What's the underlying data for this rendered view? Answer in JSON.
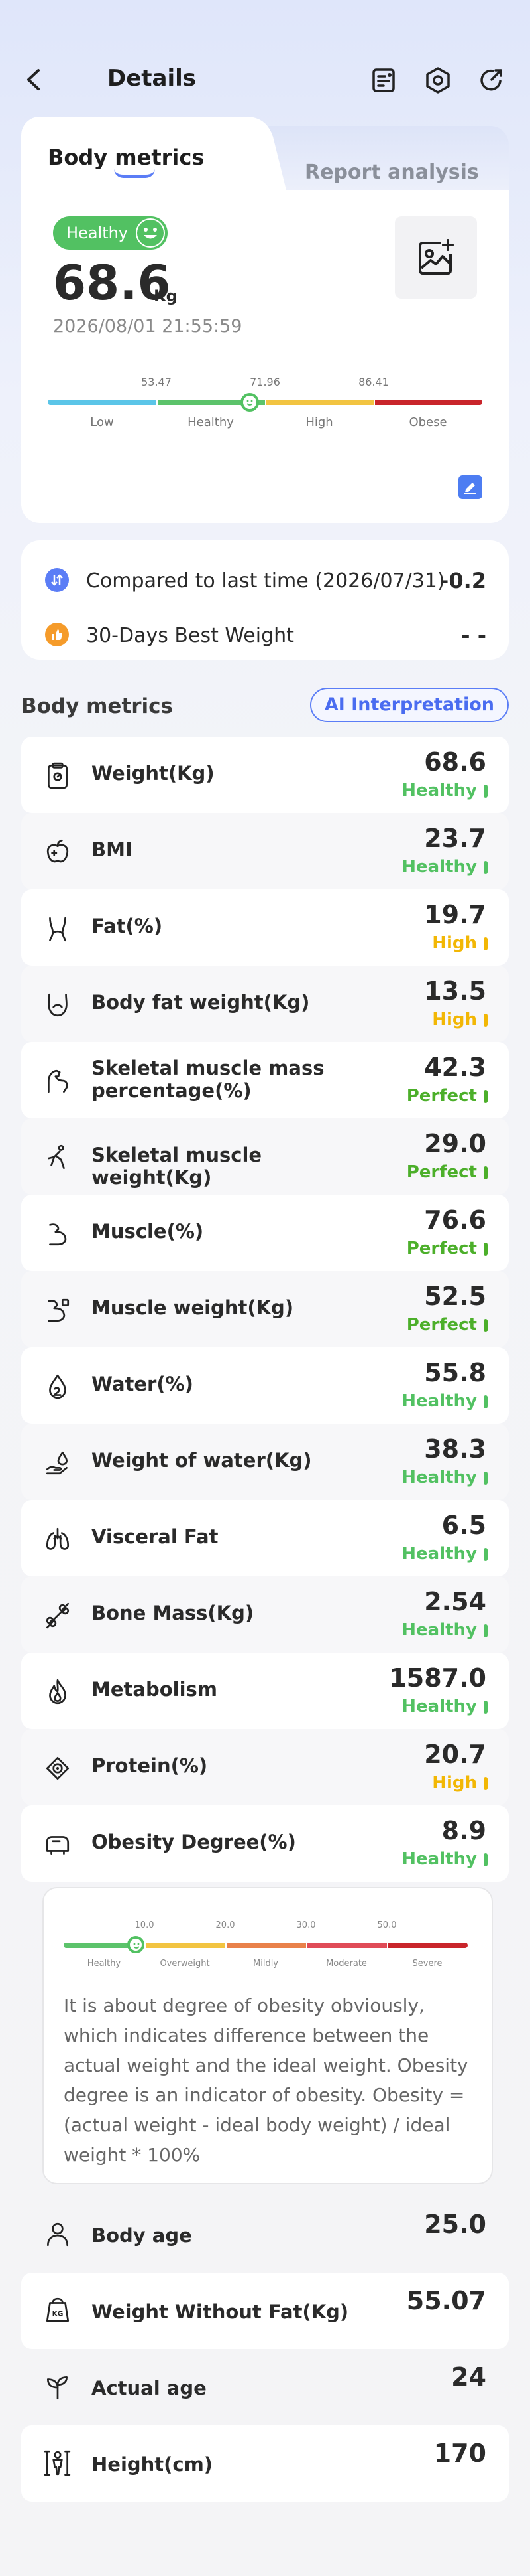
{
  "header": {
    "title": "Details"
  },
  "tabs": {
    "active": "Body metrics",
    "inactive": "Report analysis"
  },
  "summary": {
    "status": "Healthy",
    "weight": "68.6",
    "unit": "Kg",
    "timestamp": "2026/08/01 21:55:59",
    "scale": {
      "ticks": [
        "53.47",
        "71.96",
        "86.41"
      ],
      "labels": [
        "Low",
        "Healthy",
        "High",
        "Obese"
      ],
      "colors": [
        "#5bc5e8",
        "#5cc36b",
        "#f2c441",
        "#c9252b"
      ],
      "marker_position_fraction": 0.465
    }
  },
  "compare": {
    "last": {
      "label": "Compared to last time (2026/07/31)",
      "value": "-0.2"
    },
    "best": {
      "label": "30-Days Best Weight",
      "value": "- -"
    }
  },
  "metrics_section": {
    "title": "Body metrics",
    "ai_button": "AI Interpretation"
  },
  "metrics": [
    {
      "icon": "scale-icon",
      "name": "Weight(Kg)",
      "value": "68.6",
      "status": "Healthy",
      "color": "#52c162"
    },
    {
      "icon": "apple-icon",
      "name": "BMI",
      "value": "23.7",
      "status": "Healthy",
      "color": "#52c162"
    },
    {
      "icon": "torso-icon",
      "name": "Fat(%)",
      "value": "19.7",
      "status": "High",
      "color": "#f2b705"
    },
    {
      "icon": "belly-icon",
      "name": "Body fat weight(Kg)",
      "value": "13.5",
      "status": "High",
      "color": "#f2b705"
    },
    {
      "icon": "arm-muscle-icon",
      "name": "Skeletal muscle mass percentage(%)",
      "value": "42.3",
      "status": "Perfect",
      "color": "#4caf2a"
    },
    {
      "icon": "runner-icon",
      "name": "Skeletal muscle weight(Kg)",
      "value": "29.0",
      "status": "Perfect",
      "color": "#4caf2a"
    },
    {
      "icon": "bicep-icon",
      "name": "Muscle(%)",
      "value": "76.6",
      "status": "Perfect",
      "color": "#4caf2a"
    },
    {
      "icon": "bicep-weight-icon",
      "name": "Muscle weight(Kg)",
      "value": "52.5",
      "status": "Perfect",
      "color": "#4caf2a"
    },
    {
      "icon": "water-drop-icon",
      "name": "Water(%)",
      "value": "55.8",
      "status": "Healthy",
      "color": "#52c162"
    },
    {
      "icon": "water-hand-icon",
      "name": "Weight of water(Kg)",
      "value": "38.3",
      "status": "Healthy",
      "color": "#52c162"
    },
    {
      "icon": "lungs-icon",
      "name": "Visceral Fat",
      "value": "6.5",
      "status": "Healthy",
      "color": "#52c162"
    },
    {
      "icon": "bone-icon",
      "name": "Bone Mass(Kg)",
      "value": "2.54",
      "status": "Healthy",
      "color": "#52c162"
    },
    {
      "icon": "flame-icon",
      "name": "Metabolism",
      "value": "1587.0",
      "status": "Healthy",
      "color": "#52c162"
    },
    {
      "icon": "protein-icon",
      "name": "Protein(%)",
      "value": "20.7",
      "status": "High",
      "color": "#f2b705"
    },
    {
      "icon": "obesity-icon",
      "name": "Obesity Degree(%)",
      "value": "8.9",
      "status": "Healthy",
      "color": "#52c162"
    }
  ],
  "obesity": {
    "ticks": [
      "10.0",
      "20.0",
      "30.0",
      "50.0"
    ],
    "labels": [
      "Healthy",
      "Overweight",
      "Mildly",
      "Moderate",
      "Severe"
    ],
    "colors": [
      "#5cc36b",
      "#f2c441",
      "#e9814a",
      "#e04b57",
      "#c9252b"
    ],
    "marker_position_fraction": 0.178,
    "description": "It is about degree of obesity obviously, which indicates difference between the actual weight and the ideal weight. Obesity degree is an indicator of obesity. Obesity = (actual weight - ideal body weight) / ideal weight * 100%"
  },
  "extras": [
    {
      "icon": "person-icon",
      "name": "Body age",
      "value": "25.0"
    },
    {
      "icon": "kg-weight-icon",
      "name": "Weight Without Fat(Kg)",
      "value": "55.07"
    },
    {
      "icon": "sprout-icon",
      "name": "Actual age",
      "value": "24"
    },
    {
      "icon": "height-icon",
      "name": "Height(cm)",
      "value": "170"
    }
  ]
}
